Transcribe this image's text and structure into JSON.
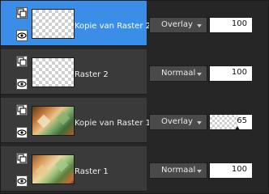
{
  "layers": [
    {
      "name": "Kopie van Raster 2",
      "blend_mode": "Overlay",
      "opacity": 100,
      "selected": true
    },
    {
      "name": "Raster 2",
      "blend_mode": "Normaal",
      "opacity": 100,
      "selected": false
    },
    {
      "name": "Kopie van Raster 1",
      "blend_mode": "Overlay",
      "opacity": 65,
      "selected": false
    },
    {
      "name": "Raster 1",
      "blend_mode": "Normaal",
      "opacity": 100,
      "selected": false
    }
  ],
  "icons": {
    "group": "layer-group-icon",
    "visibility": "eye-icon",
    "dropdown": "chevron-down-icon"
  },
  "colors": {
    "selected": "#3a8ee8",
    "row": "#3a3a3a"
  }
}
